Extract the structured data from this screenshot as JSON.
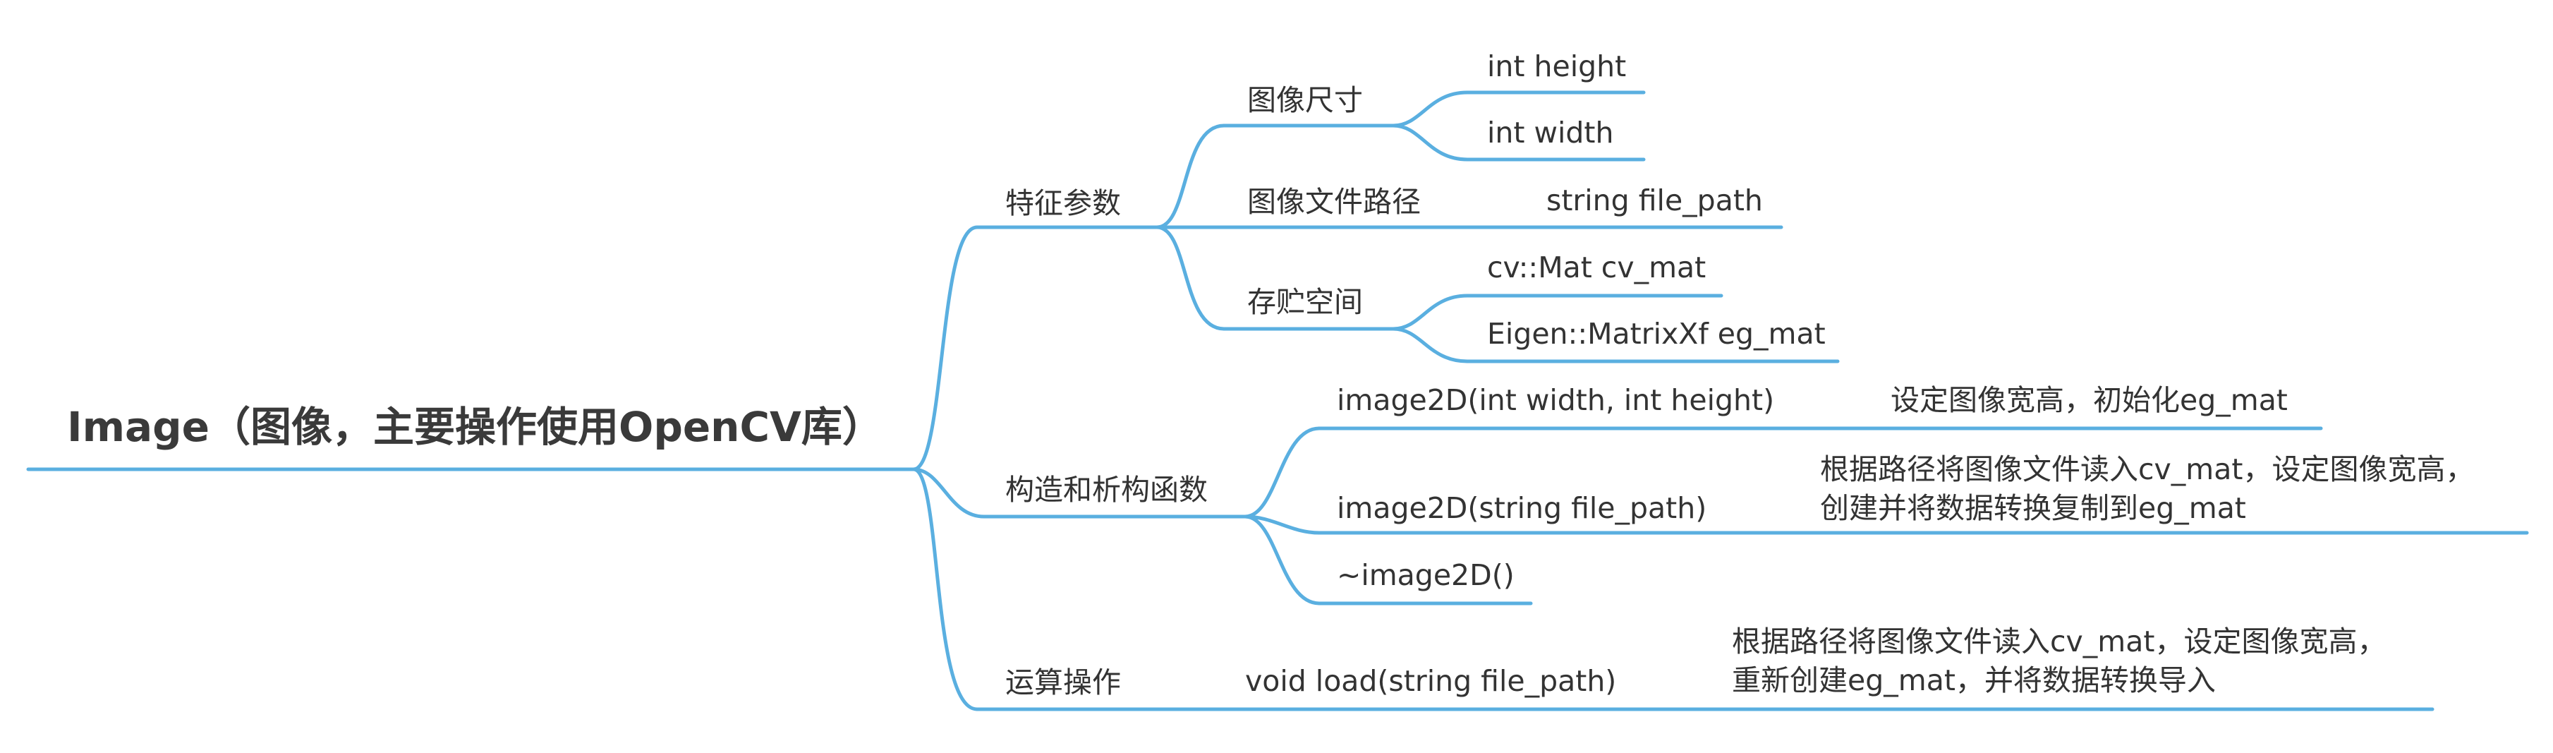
{
  "root": {
    "label": "Image（图像，主要操作使用OpenCV库）"
  },
  "features": {
    "label": "特征参数",
    "size": {
      "label": "图像尺寸",
      "height": "int height",
      "width": "int width"
    },
    "path": {
      "label": "图像文件路径",
      "value": "string file_path"
    },
    "storage": {
      "label": "存贮空间",
      "cv": "cv::Mat cv_mat",
      "eg": "Eigen::MatrixXf eg_mat"
    }
  },
  "ctor": {
    "label": "构造和析构函数",
    "c1": {
      "label": "image2D(int width, int height)",
      "note": "设定图像宽高，初始化eg_mat"
    },
    "c2": {
      "label": "image2D(string file_path)",
      "note1": "根据路径将图像文件读入cv_mat，设定图像宽高，",
      "note2": "创建并将数据转换复制到eg_mat"
    },
    "dtor": {
      "label": "~image2D()"
    }
  },
  "ops": {
    "label": "运算操作",
    "load": {
      "label": "void load(string file_path)",
      "note1": "根据路径将图像文件读入cv_mat，设定图像宽高，",
      "note2": "重新创建eg_mat，并将数据转换导入"
    }
  },
  "colors": {
    "line": "#5aafe0",
    "text": "#333333"
  }
}
